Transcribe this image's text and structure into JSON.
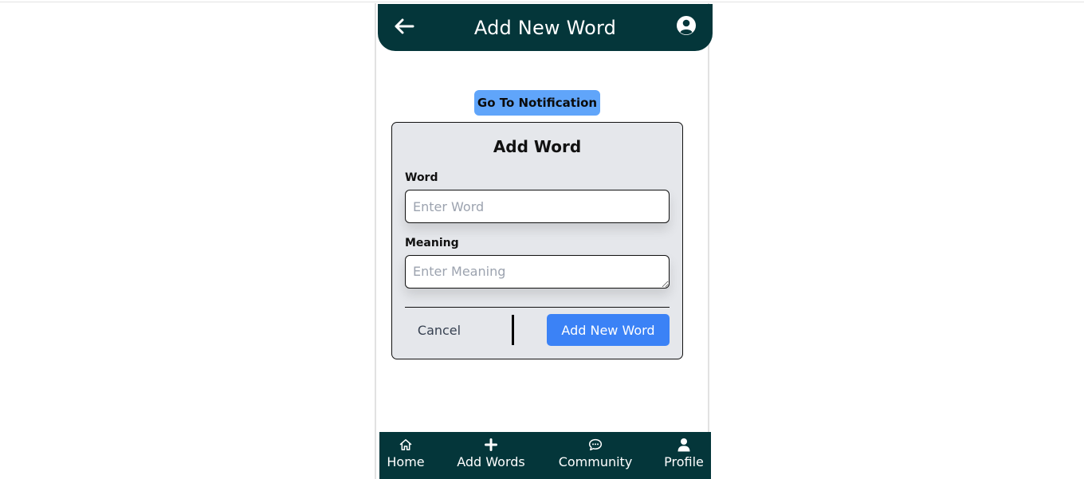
{
  "header": {
    "title": "Add New Word",
    "back_icon": "arrow-left-icon",
    "profile_icon": "user-circle-icon"
  },
  "notification_button": {
    "label": "Go To Notification"
  },
  "form": {
    "title": "Add Word",
    "word": {
      "label": "Word",
      "value": "",
      "placeholder": "Enter Word"
    },
    "meaning": {
      "label": "Meaning",
      "value": "",
      "placeholder": "Enter Meaning"
    },
    "cancel_label": "Cancel",
    "submit_label": "Add New Word"
  },
  "bottom_nav": {
    "items": [
      {
        "label": "Home",
        "icon": "home-icon"
      },
      {
        "label": "Add Words",
        "icon": "plus-icon"
      },
      {
        "label": "Community",
        "icon": "chat-icon"
      },
      {
        "label": "Profile",
        "icon": "user-icon"
      }
    ]
  },
  "colors": {
    "header_bg": "#04363a",
    "accent_blue": "#3b82f6",
    "notification_blue": "#60a5fa",
    "card_bg": "#e5e7eb"
  }
}
